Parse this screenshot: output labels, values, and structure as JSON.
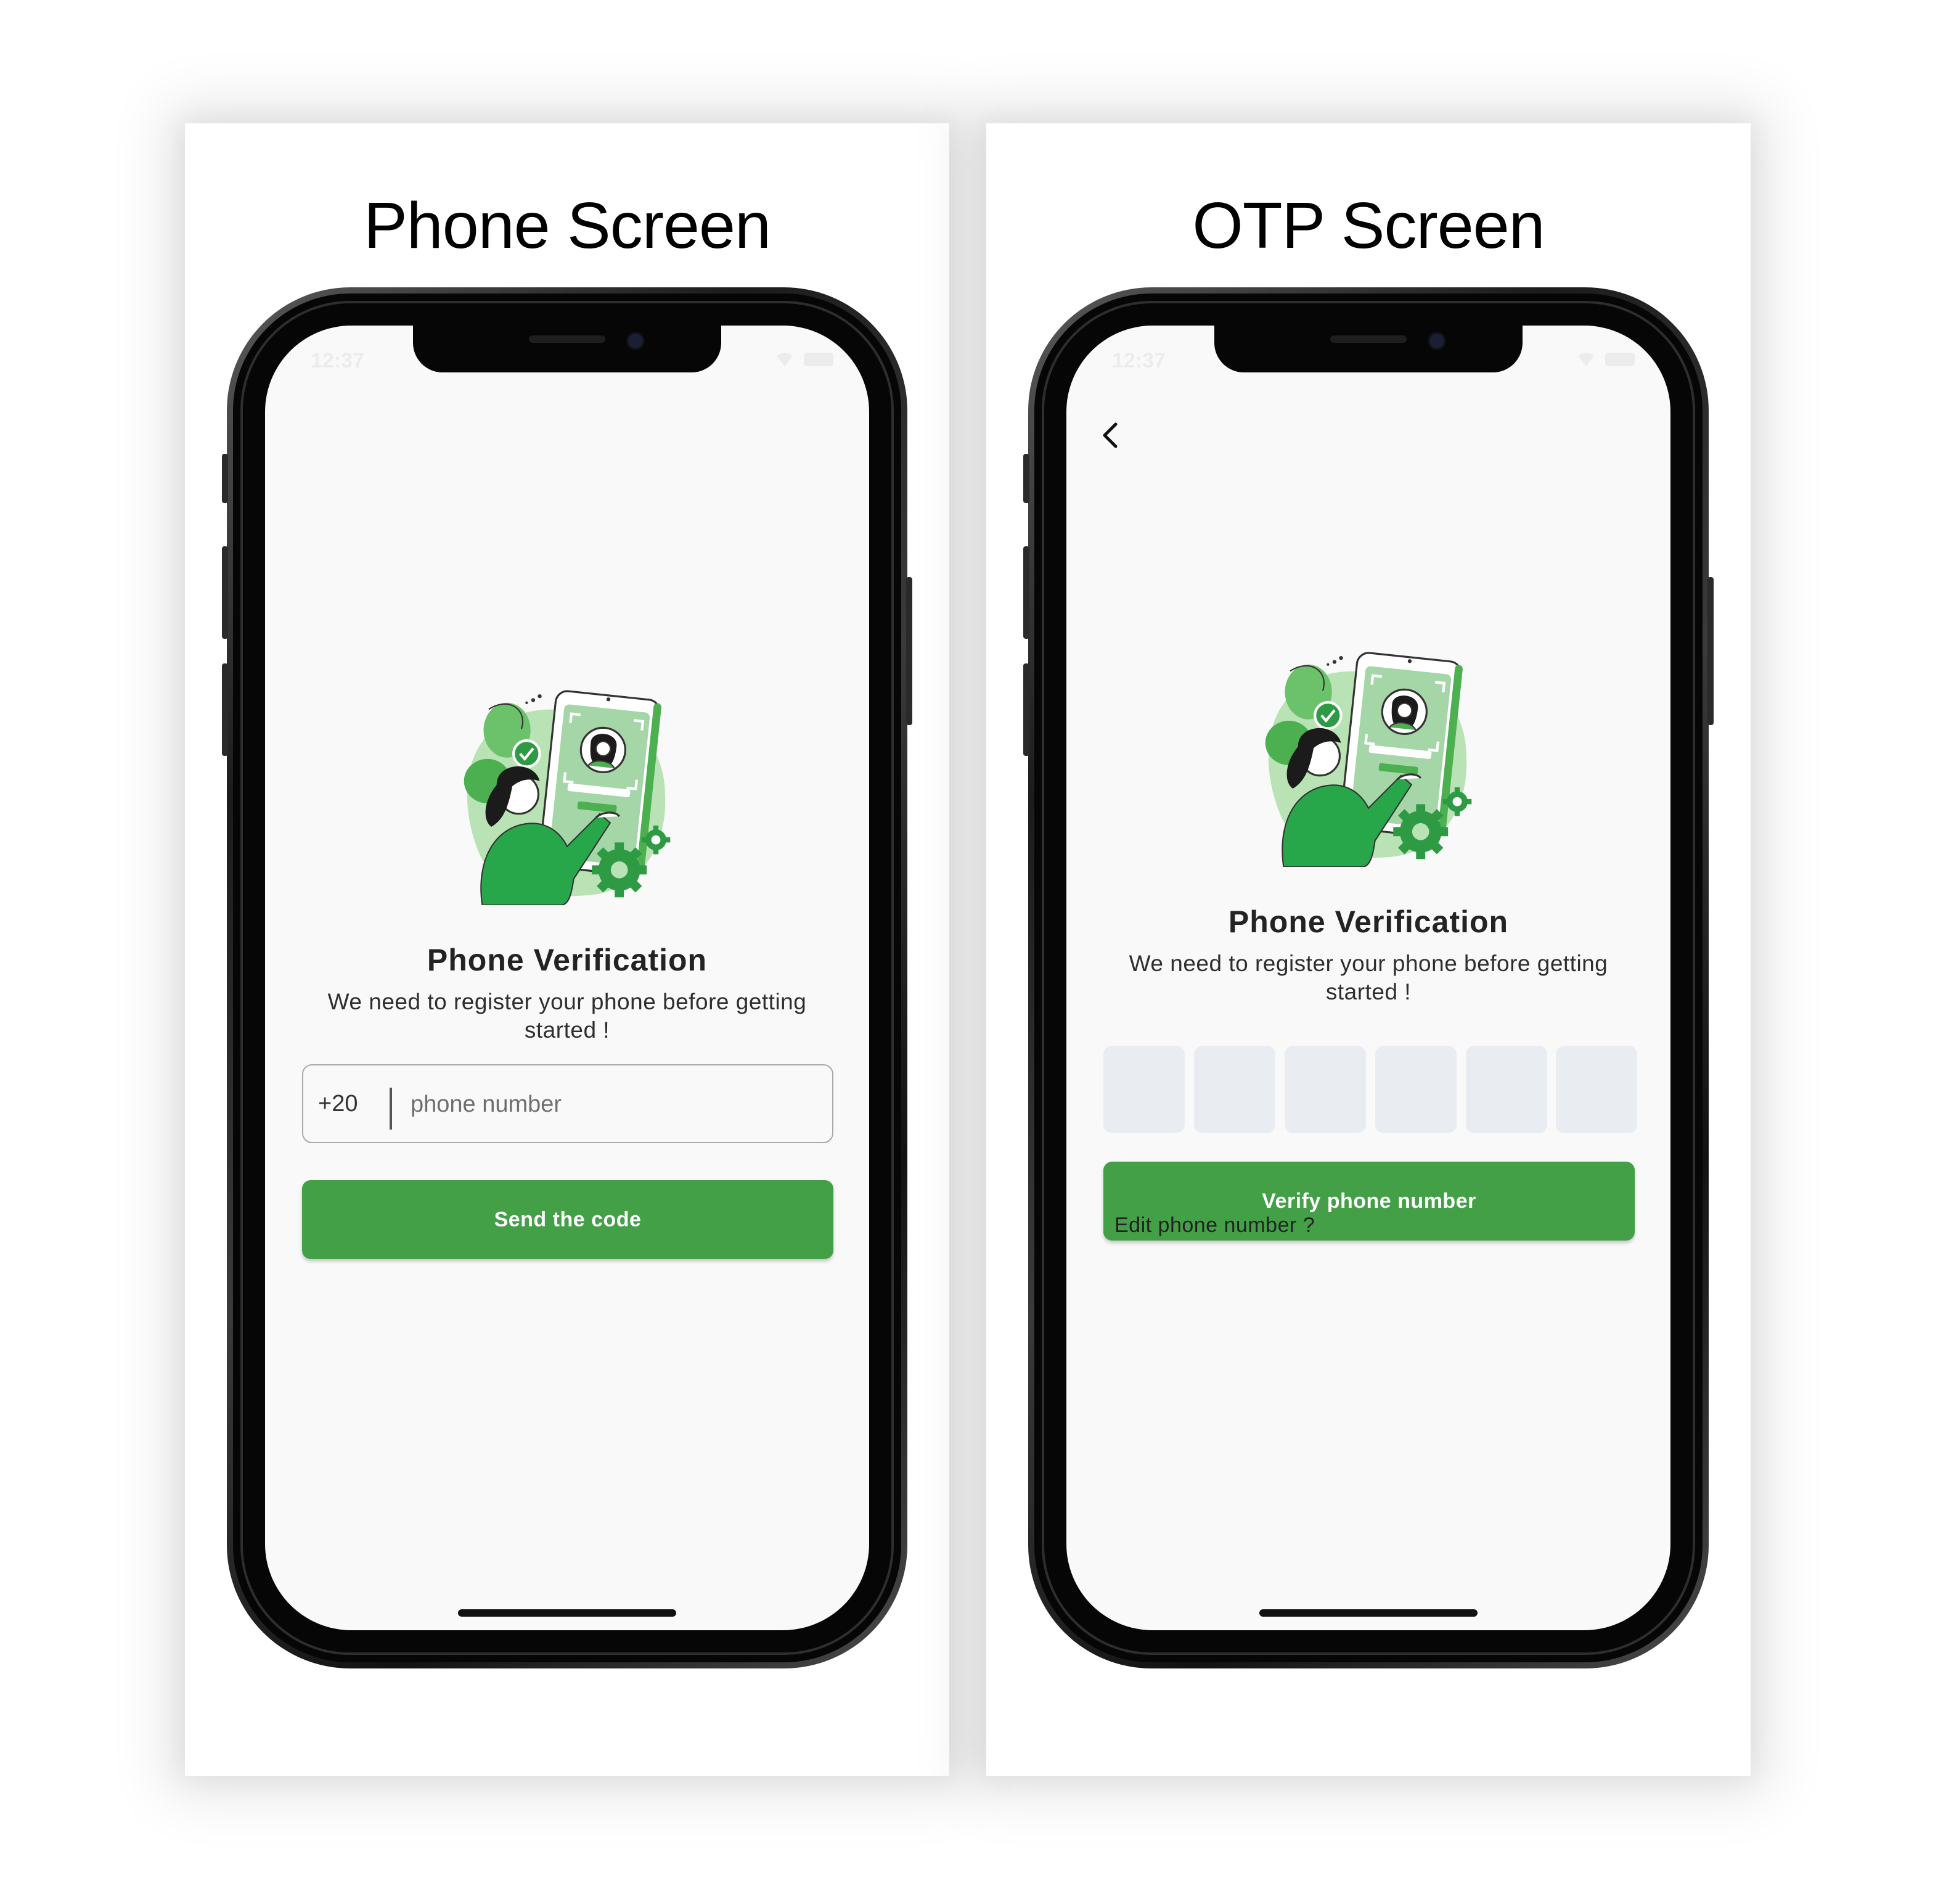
{
  "colors": {
    "accent": "#43a047",
    "otp_box": "#e9edf1",
    "screen_bg": "#f9f9f9"
  },
  "phone_screen": {
    "card_title": "Phone Screen",
    "status_time": "12:37",
    "heading": "Phone Verification",
    "subtitle": "We need to register your phone before getting started !",
    "country_code": "+20",
    "phone_placeholder": "phone number",
    "send_button": "Send the code"
  },
  "otp_screen": {
    "card_title": "OTP Screen",
    "status_time": "12:37",
    "back_icon": "chevron-left-icon",
    "heading": "Phone Verification",
    "subtitle": "We need to register your phone before getting started !",
    "otp_digits": [
      "",
      "",
      "",
      "",
      "",
      ""
    ],
    "verify_button": "Verify phone number",
    "edit_link": "Edit phone number ?"
  }
}
